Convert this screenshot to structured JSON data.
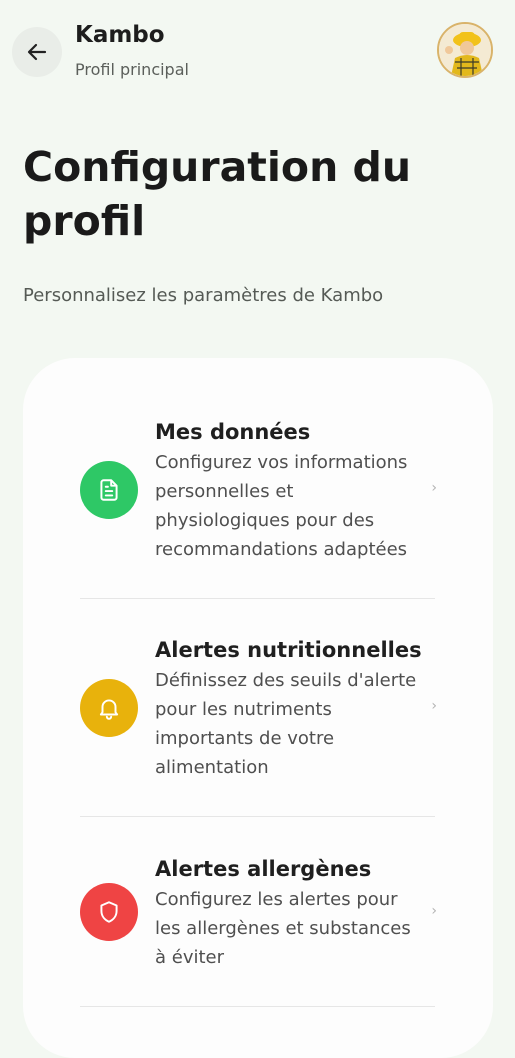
{
  "header": {
    "title": "Kambo",
    "subtitle": "Profil principal"
  },
  "page": {
    "title": "Configuration du profil",
    "subtitle": "Personnalisez les paramètres de Kambo"
  },
  "items": [
    {
      "title": "Mes données",
      "description": "Configurez vos informations personnelles et physiologiques pour des recommandations adaptées",
      "icon": "document-icon",
      "color": "#2ec866"
    },
    {
      "title": "Alertes nutritionnelles",
      "description": "Définissez des seuils d'alerte pour les nutriments importants de votre alimentation",
      "icon": "bell-icon",
      "color": "#e8b20c"
    },
    {
      "title": "Alertes allergènes",
      "description": "Configurez les alertes pour les allergènes et substances à éviter",
      "icon": "shield-icon",
      "color": "#ef4444"
    }
  ],
  "chevron": "›"
}
